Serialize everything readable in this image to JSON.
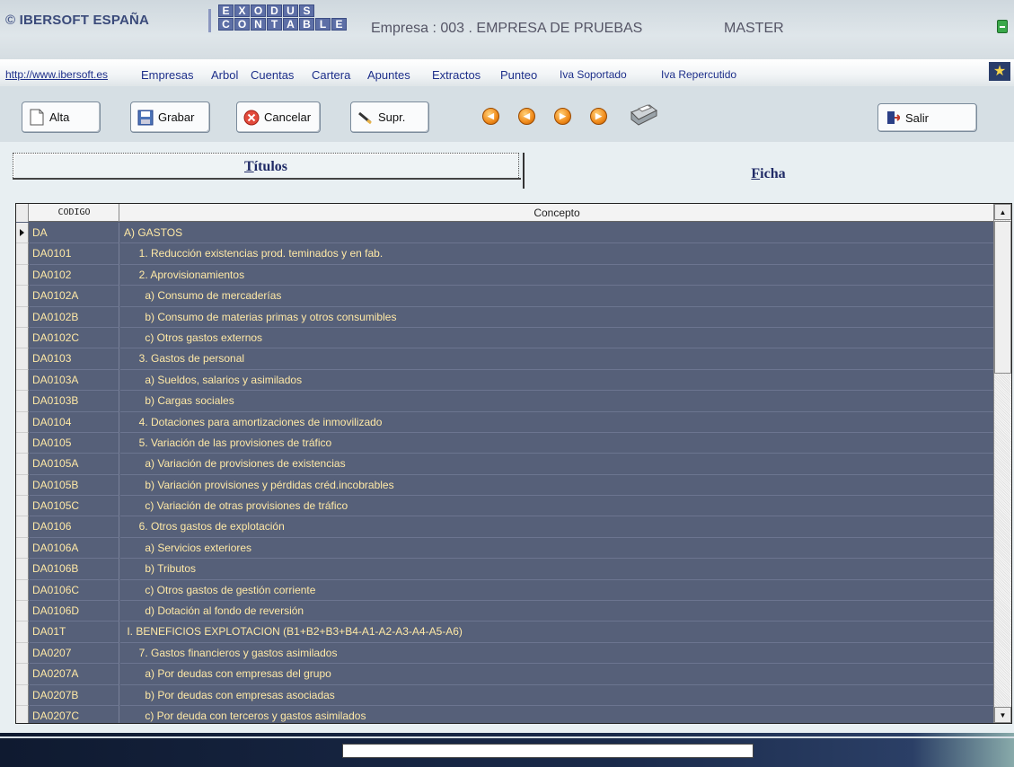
{
  "header": {
    "brand": "IBERSOFT ESPAÑA",
    "brand_symbol": "©",
    "product_line1": [
      "E",
      "X",
      "O",
      "D",
      "U",
      "S"
    ],
    "product_line2": [
      "C",
      "O",
      "N",
      "T",
      "A",
      "B",
      "L",
      "E"
    ],
    "company": "Empresa : 003 . EMPRESA DE PRUEBAS",
    "user": "MASTER"
  },
  "menu": {
    "link": "http://www.ibersoft.es",
    "items": [
      "Empresas",
      "Arbol",
      "Cuentas",
      "Cartera",
      "Apuntes",
      "Extractos",
      "Punteo"
    ],
    "extra": [
      "Iva Soportado",
      "Iva Repercutido"
    ]
  },
  "toolbar": {
    "alta": "Alta",
    "grabar": "Grabar",
    "cancelar": "Cancelar",
    "supr": "Supr.",
    "salir": "Salir"
  },
  "tabs": {
    "titulos_first": "T",
    "titulos_rest": "ítulos",
    "ficha_first": "F",
    "ficha_rest": "icha"
  },
  "grid": {
    "col_codigo": "CODIGO",
    "col_concepto": "Concepto",
    "rows": [
      {
        "codigo": "DA",
        "concepto": "A) GASTOS"
      },
      {
        "codigo": "DA0101",
        "concepto": "     1. Reducción existencias prod. teminados y en fab."
      },
      {
        "codigo": "DA0102",
        "concepto": "     2. Aprovisionamientos"
      },
      {
        "codigo": "DA0102A",
        "concepto": "       a) Consumo de mercaderías"
      },
      {
        "codigo": "DA0102B",
        "concepto": "       b) Consumo de materias primas y otros consumibles"
      },
      {
        "codigo": "DA0102C",
        "concepto": "       c) Otros gastos externos"
      },
      {
        "codigo": "DA0103",
        "concepto": "     3. Gastos de personal"
      },
      {
        "codigo": "DA0103A",
        "concepto": "       a) Sueldos, salarios y asimilados"
      },
      {
        "codigo": "DA0103B",
        "concepto": "       b) Cargas sociales"
      },
      {
        "codigo": "DA0104",
        "concepto": "     4. Dotaciones para amortizaciones de inmovilizado"
      },
      {
        "codigo": "DA0105",
        "concepto": "     5. Variación de las provisiones de tráfico"
      },
      {
        "codigo": "DA0105A",
        "concepto": "       a) Variación de provisiones de existencias"
      },
      {
        "codigo": "DA0105B",
        "concepto": "       b) Variación provisiones y pérdidas créd.incobrables"
      },
      {
        "codigo": "DA0105C",
        "concepto": "       c) Variación de otras provisiones de tráfico"
      },
      {
        "codigo": "DA0106",
        "concepto": "     6. Otros gastos de explotación"
      },
      {
        "codigo": "DA0106A",
        "concepto": "       a) Servicios exteriores"
      },
      {
        "codigo": "DA0106B",
        "concepto": "       b) Tributos"
      },
      {
        "codigo": "DA0106C",
        "concepto": "       c) Otros gastos de gestión corriente"
      },
      {
        "codigo": "DA0106D",
        "concepto": "       d) Dotación al fondo de reversión"
      },
      {
        "codigo": "DA01T",
        "concepto": " I. BENEFICIOS EXPLOTACION (B1+B2+B3+B4-A1-A2-A3-A4-A5-A6)"
      },
      {
        "codigo": "DA0207",
        "concepto": "     7. Gastos financieros y gastos asimilados"
      },
      {
        "codigo": "DA0207A",
        "concepto": "       a) Por deudas con empresas del grupo"
      },
      {
        "codigo": "DA0207B",
        "concepto": "       b) Por deudas con empresas asociadas"
      },
      {
        "codigo": "DA0207C",
        "concepto": "       c) Por deuda con terceros y gastos asimilados"
      }
    ]
  }
}
